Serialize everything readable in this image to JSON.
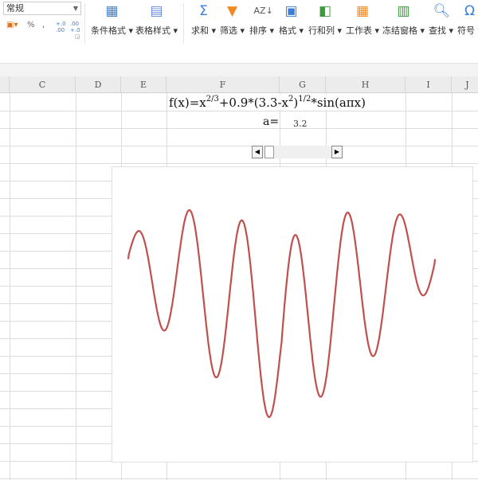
{
  "ribbon": {
    "number_format": "常规",
    "small_buttons": [
      "%",
      ",",
      ".0→.00",
      ".00→.0"
    ],
    "tools": [
      {
        "label": "条件格式",
        "icon": "conditional-format-icon"
      },
      {
        "label": "表格样式",
        "icon": "table-style-icon"
      },
      {
        "label": "求和",
        "icon": "sigma-icon"
      },
      {
        "label": "筛选",
        "icon": "filter-icon"
      },
      {
        "label": "排序",
        "icon": "sort-icon"
      },
      {
        "label": "格式",
        "icon": "format-icon"
      },
      {
        "label": "行和列",
        "icon": "row-col-icon"
      },
      {
        "label": "工作表",
        "icon": "worksheet-icon"
      },
      {
        "label": "冻结窗格",
        "icon": "freeze-pane-icon"
      },
      {
        "label": "查找",
        "icon": "find-icon"
      },
      {
        "label": "符号",
        "icon": "omega-icon"
      }
    ],
    "colors": {
      "accent": "#3b7dd8",
      "filter": "#f08a24"
    }
  },
  "columns": [
    "C",
    "D",
    "E",
    "F",
    "G",
    "H",
    "I",
    "J"
  ],
  "sheet": {
    "formula_parts": [
      "f(x)=x",
      "2/3",
      "+0.9*(3.3-x",
      "2",
      ")",
      "1/2",
      "*sin(aπx)"
    ],
    "a_label": "a=",
    "a_value": "3.2"
  },
  "chart_data": {
    "type": "line",
    "function": "f(x)=x^(2/3)+0.9*(3.3-x^2)^(1/2)*sin(a*pi*x)",
    "a": 3.2,
    "x_range": [
      -1.8166,
      1.8166
    ],
    "line_color": "#c0504d",
    "axes_visible": false,
    "grid": false
  }
}
